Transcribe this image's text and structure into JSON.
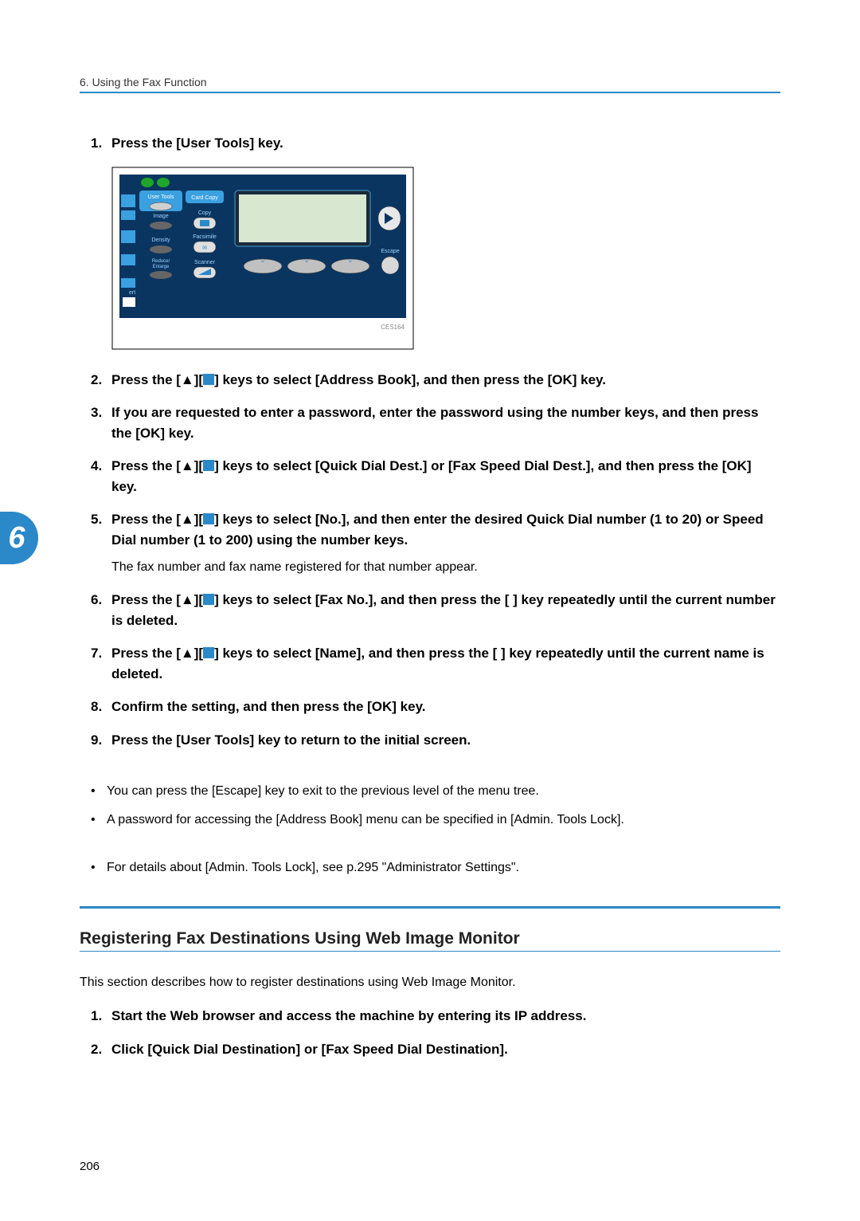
{
  "header": {
    "chapter": "6. Using the Fax Function"
  },
  "steps": [
    {
      "num": "1.",
      "text": "Press the [User Tools] key."
    },
    {
      "num": "2.",
      "prefix": "Press the [▲][",
      "suffix": "] keys to select [Address Book], and then press the [OK] key."
    },
    {
      "num": "3.",
      "text": "If you are requested to enter a password, enter the password using the number keys, and then press the [OK] key."
    },
    {
      "num": "4.",
      "prefix": "Press the [▲][",
      "suffix": "] keys to select [Quick Dial Dest.] or [Fax Speed Dial Dest.], and then press the [OK] key."
    },
    {
      "num": "5.",
      "prefix": "Press the [▲][",
      "suffix": "] keys to select [No.], and then enter the desired Quick Dial number (1 to 20) or Speed Dial number (1 to 200) using the number keys.",
      "sub": "The fax number and fax name registered for that number appear."
    },
    {
      "num": "6.",
      "prefix": "Press the [▲][",
      "suffix": "] keys to select [Fax No.], and then press the [   ] key repeatedly until the current number is deleted."
    },
    {
      "num": "7.",
      "prefix": "Press the [▲][",
      "suffix": "] keys to select [Name], and then press the [   ] key repeatedly until the current name is deleted."
    },
    {
      "num": "8.",
      "text": "Confirm the setting, and then press the [OK] key."
    },
    {
      "num": "9.",
      "text": "Press the [User Tools] key to return to the initial screen."
    }
  ],
  "notes": [
    "You can press the [Escape] key to exit to the previous level of the menu tree.",
    "A password for accessing the [Address Book] menu can be specified in [Admin. Tools Lock]."
  ],
  "refs": [
    "For details about [Admin. Tools Lock], see p.295 \"Administrator Settings\"."
  ],
  "section2": {
    "heading": "Registering Fax Destinations Using Web Image Monitor",
    "intro": "This section describes how to register destinations using Web Image Monitor.",
    "steps": [
      {
        "num": "1.",
        "text": "Start the Web browser and access the machine by entering its IP address."
      },
      {
        "num": "2.",
        "text": "Click [Quick Dial Destination] or [Fax Speed Dial Destination]."
      }
    ]
  },
  "pageNumber": "206",
  "tabNumber": "6",
  "panel": {
    "userTools": "User Tools",
    "cardCopy": "Card Copy",
    "image": "Image",
    "copy": "Copy",
    "density": "Density",
    "facsimile": "Facsimile",
    "reduce": "Reduce/\nEnlarge",
    "scanner": "Scanner",
    "escape": "Escape",
    "caption": "CES164"
  }
}
